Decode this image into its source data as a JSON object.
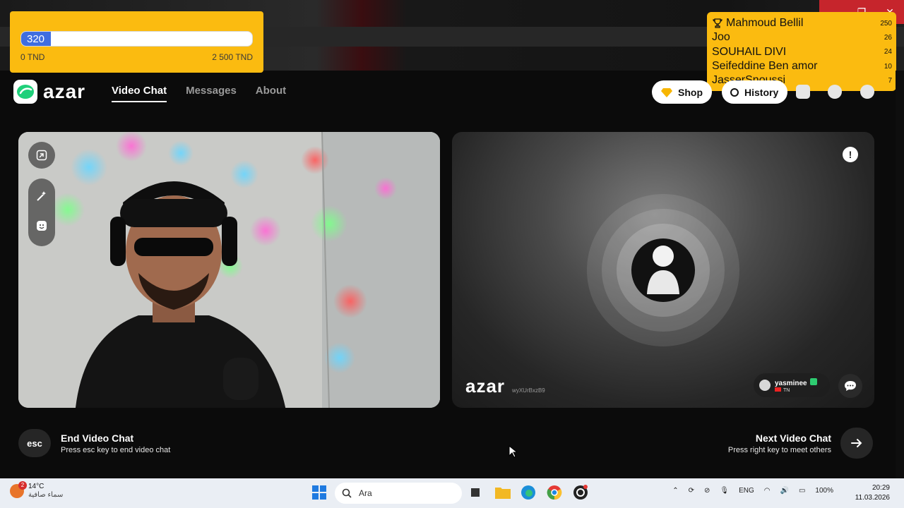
{
  "window": {
    "controls": [
      "—",
      "❐",
      "✕"
    ]
  },
  "goal": {
    "current": "320",
    "progress_fraction": 0.128,
    "min_label": "0 TND",
    "max_label": "2 500 TND"
  },
  "leaderboard": [
    {
      "name": "Mahmoud Bellil",
      "amount": "250"
    },
    {
      "name": "Joo",
      "amount": "26"
    },
    {
      "name": "SOUHAIL DIVI",
      "amount": "24"
    },
    {
      "name": "Seifeddine Ben amor",
      "amount": "10"
    },
    {
      "name": "JasserSnoussi",
      "amount": "7"
    }
  ],
  "header": {
    "logo_text": "azar",
    "nav": [
      "Video Chat",
      "Messages",
      "About"
    ],
    "shop_label": "Shop",
    "history_label": "History"
  },
  "peer": {
    "watermark": "azar",
    "watermark_id": "wyXUrBxzB9",
    "username": "yasminee",
    "country": "TN",
    "report_symbol": "!"
  },
  "controls": {
    "esc_key": "esc",
    "end_title": "End Video Chat",
    "end_sub": "Press esc key to end video chat",
    "next_title": "Next Video Chat",
    "next_sub": "Press right key to meet others"
  },
  "taskbar": {
    "weather_badge": "2",
    "temperature": "14°C",
    "condition": "سماء صافية",
    "search_placeholder": "Ara",
    "lang": "ENG",
    "battery": "100%",
    "time": "20:29",
    "date": "11.03.2026"
  },
  "colors": {
    "overlay_yellow": "#fbbb10",
    "progress_blue": "#3f6de0",
    "accent_green": "#2ecc71"
  }
}
